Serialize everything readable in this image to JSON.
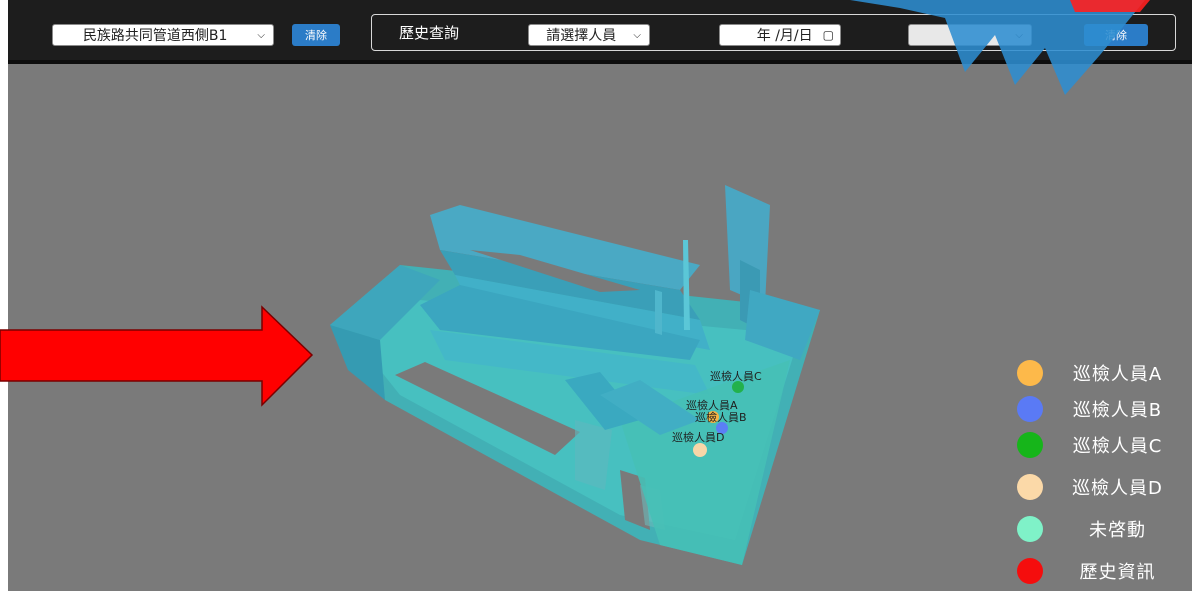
{
  "toolbar": {
    "location_select": "民族路共同管道西側B1",
    "clear_label": "清除",
    "history_label": "歷史查詢",
    "person_select": "請選擇人員",
    "date_placeholder": "年 /月/日",
    "history_select": "",
    "history_clear_label": "清除"
  },
  "markers": [
    {
      "label": "巡檢人員C",
      "color": "#22b14c"
    },
    {
      "label": "巡檢人員A",
      "color": "#f5b445"
    },
    {
      "label": "巡檢人員B",
      "color": "#5b7ff5"
    },
    {
      "label": "巡檢人員D",
      "color": "#f8d6a8"
    }
  ],
  "legend": [
    {
      "label": "巡檢人員A",
      "color": "#fdb94a"
    },
    {
      "label": "巡檢人員B",
      "color": "#5a7af5"
    },
    {
      "label": "巡檢人員C",
      "color": "#16b51a"
    },
    {
      "label": "巡檢人員D",
      "color": "#fbd9a8"
    },
    {
      "label": "未啓動",
      "color": "#7ff2c8"
    },
    {
      "label": "歷史資訊",
      "color": "#f50d0d"
    }
  ],
  "overlay": {
    "arrow_color": "#ff0000",
    "burst_color": "#2d8dd0"
  }
}
